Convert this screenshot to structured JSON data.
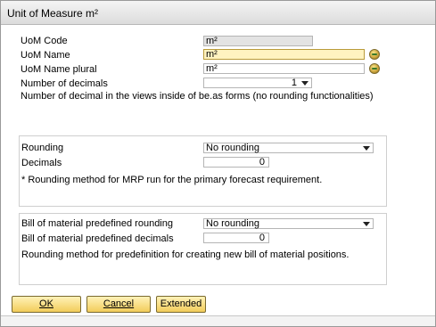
{
  "window": {
    "title": "Unit of Measure m²"
  },
  "form": {
    "uom_code_label": "UoM Code",
    "uom_code_value": "m²",
    "uom_name_label": "UoM Name",
    "uom_name_value": "m²",
    "uom_name_plural_label": "UoM Name plural",
    "uom_name_plural_value": "m²",
    "decimals_label": "Number of decimals",
    "decimals_value": "1",
    "decimals_note": "Number of decimal in the views inside of be.as forms (no rounding functionalities)"
  },
  "rounding_group": {
    "rounding_label": "Rounding",
    "rounding_value": "No rounding",
    "decimals_label": "Decimals",
    "decimals_value": "0",
    "note": "* Rounding method for MRP run for the primary forecast requirement."
  },
  "bom_group": {
    "rounding_label": "Bill of material predefined rounding",
    "rounding_value": "No rounding",
    "decimals_label": "Bill of material predefined decimals",
    "decimals_value": "0",
    "note": "Rounding method for predefinition for creating new bill of material positions."
  },
  "buttons": {
    "ok_label": "OK",
    "cancel_label": "Cancel",
    "extended_label": "Extended"
  },
  "icons": {
    "link": "link-arrow-icon",
    "dropdown": "chevron-down-icon"
  },
  "colors": {
    "button_fill": "#f2cc5a",
    "required_field_fill": "#fff3c0",
    "readonly_field_fill": "#e3e3e3"
  }
}
